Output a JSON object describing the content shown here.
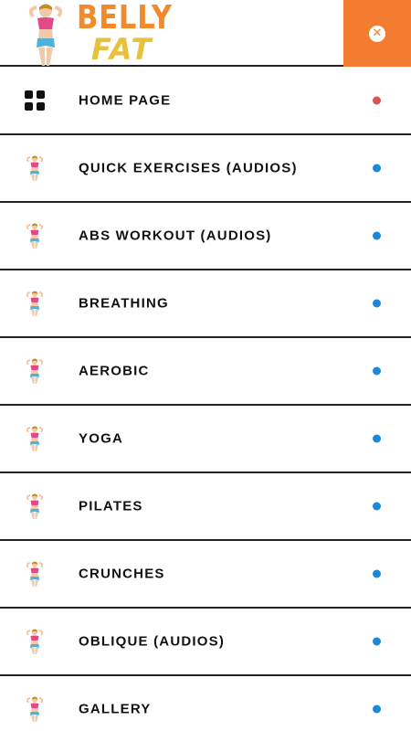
{
  "header": {
    "logo_line1": "BELLY",
    "logo_line2": "FAT",
    "close_icon": "close-icon",
    "close_symbol": "✕"
  },
  "menu": {
    "items": [
      {
        "label": "HOME PAGE",
        "icon": "grid-icon",
        "dot_color": "#d9534f"
      },
      {
        "label": "QUICK EXERCISES (AUDIOS)",
        "icon": "woman-figure-icon",
        "dot_color": "#1e88d8"
      },
      {
        "label": "ABS WORKOUT (AUDIOS)",
        "icon": "woman-figure-icon",
        "dot_color": "#1e88d8"
      },
      {
        "label": "BREATHING",
        "icon": "woman-figure-icon",
        "dot_color": "#1e88d8"
      },
      {
        "label": "AEROBIC",
        "icon": "woman-figure-icon",
        "dot_color": "#1e88d8"
      },
      {
        "label": "YOGA",
        "icon": "woman-figure-icon",
        "dot_color": "#1e88d8"
      },
      {
        "label": "PILATES",
        "icon": "woman-figure-icon",
        "dot_color": "#1e88d8"
      },
      {
        "label": "CRUNCHES",
        "icon": "woman-figure-icon",
        "dot_color": "#1e88d8"
      },
      {
        "label": "OBLIQUE (AUDIOS)",
        "icon": "woman-figure-icon",
        "dot_color": "#1e88d8"
      },
      {
        "label": "GALLERY",
        "icon": "woman-figure-icon",
        "dot_color": "#1e88d8"
      }
    ]
  },
  "colors": {
    "accent_orange": "#f47c30",
    "logo_orange": "#f08a2a",
    "logo_gold": "#e6c23a",
    "active_dot": "#d9534f",
    "inactive_dot": "#1e88d8"
  }
}
